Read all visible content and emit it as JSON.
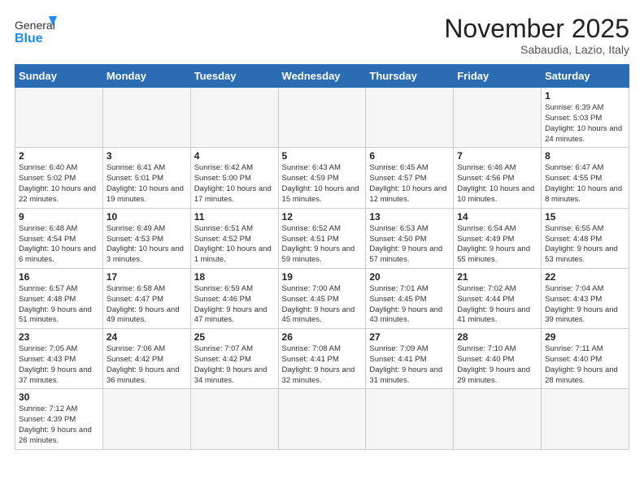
{
  "header": {
    "logo_general": "General",
    "logo_blue": "Blue",
    "month_title": "November 2025",
    "location": "Sabaudia, Lazio, Italy"
  },
  "weekdays": [
    "Sunday",
    "Monday",
    "Tuesday",
    "Wednesday",
    "Thursday",
    "Friday",
    "Saturday"
  ],
  "weeks": [
    [
      {
        "day": "",
        "info": ""
      },
      {
        "day": "",
        "info": ""
      },
      {
        "day": "",
        "info": ""
      },
      {
        "day": "",
        "info": ""
      },
      {
        "day": "",
        "info": ""
      },
      {
        "day": "",
        "info": ""
      },
      {
        "day": "1",
        "info": "Sunrise: 6:39 AM\nSunset: 5:03 PM\nDaylight: 10 hours\nand 24 minutes."
      }
    ],
    [
      {
        "day": "2",
        "info": "Sunrise: 6:40 AM\nSunset: 5:02 PM\nDaylight: 10 hours\nand 22 minutes."
      },
      {
        "day": "3",
        "info": "Sunrise: 6:41 AM\nSunset: 5:01 PM\nDaylight: 10 hours\nand 19 minutes."
      },
      {
        "day": "4",
        "info": "Sunrise: 6:42 AM\nSunset: 5:00 PM\nDaylight: 10 hours\nand 17 minutes."
      },
      {
        "day": "5",
        "info": "Sunrise: 6:43 AM\nSunset: 4:59 PM\nDaylight: 10 hours\nand 15 minutes."
      },
      {
        "day": "6",
        "info": "Sunrise: 6:45 AM\nSunset: 4:57 PM\nDaylight: 10 hours\nand 12 minutes."
      },
      {
        "day": "7",
        "info": "Sunrise: 6:46 AM\nSunset: 4:56 PM\nDaylight: 10 hours\nand 10 minutes."
      },
      {
        "day": "8",
        "info": "Sunrise: 6:47 AM\nSunset: 4:55 PM\nDaylight: 10 hours\nand 8 minutes."
      }
    ],
    [
      {
        "day": "9",
        "info": "Sunrise: 6:48 AM\nSunset: 4:54 PM\nDaylight: 10 hours\nand 6 minutes."
      },
      {
        "day": "10",
        "info": "Sunrise: 6:49 AM\nSunset: 4:53 PM\nDaylight: 10 hours\nand 3 minutes."
      },
      {
        "day": "11",
        "info": "Sunrise: 6:51 AM\nSunset: 4:52 PM\nDaylight: 10 hours\nand 1 minute."
      },
      {
        "day": "12",
        "info": "Sunrise: 6:52 AM\nSunset: 4:51 PM\nDaylight: 9 hours\nand 59 minutes."
      },
      {
        "day": "13",
        "info": "Sunrise: 6:53 AM\nSunset: 4:50 PM\nDaylight: 9 hours\nand 57 minutes."
      },
      {
        "day": "14",
        "info": "Sunrise: 6:54 AM\nSunset: 4:49 PM\nDaylight: 9 hours\nand 55 minutes."
      },
      {
        "day": "15",
        "info": "Sunrise: 6:55 AM\nSunset: 4:48 PM\nDaylight: 9 hours\nand 53 minutes."
      }
    ],
    [
      {
        "day": "16",
        "info": "Sunrise: 6:57 AM\nSunset: 4:48 PM\nDaylight: 9 hours\nand 51 minutes."
      },
      {
        "day": "17",
        "info": "Sunrise: 6:58 AM\nSunset: 4:47 PM\nDaylight: 9 hours\nand 49 minutes."
      },
      {
        "day": "18",
        "info": "Sunrise: 6:59 AM\nSunset: 4:46 PM\nDaylight: 9 hours\nand 47 minutes."
      },
      {
        "day": "19",
        "info": "Sunrise: 7:00 AM\nSunset: 4:45 PM\nDaylight: 9 hours\nand 45 minutes."
      },
      {
        "day": "20",
        "info": "Sunrise: 7:01 AM\nSunset: 4:45 PM\nDaylight: 9 hours\nand 43 minutes."
      },
      {
        "day": "21",
        "info": "Sunrise: 7:02 AM\nSunset: 4:44 PM\nDaylight: 9 hours\nand 41 minutes."
      },
      {
        "day": "22",
        "info": "Sunrise: 7:04 AM\nSunset: 4:43 PM\nDaylight: 9 hours\nand 39 minutes."
      }
    ],
    [
      {
        "day": "23",
        "info": "Sunrise: 7:05 AM\nSunset: 4:43 PM\nDaylight: 9 hours\nand 37 minutes."
      },
      {
        "day": "24",
        "info": "Sunrise: 7:06 AM\nSunset: 4:42 PM\nDaylight: 9 hours\nand 36 minutes."
      },
      {
        "day": "25",
        "info": "Sunrise: 7:07 AM\nSunset: 4:42 PM\nDaylight: 9 hours\nand 34 minutes."
      },
      {
        "day": "26",
        "info": "Sunrise: 7:08 AM\nSunset: 4:41 PM\nDaylight: 9 hours\nand 32 minutes."
      },
      {
        "day": "27",
        "info": "Sunrise: 7:09 AM\nSunset: 4:41 PM\nDaylight: 9 hours\nand 31 minutes."
      },
      {
        "day": "28",
        "info": "Sunrise: 7:10 AM\nSunset: 4:40 PM\nDaylight: 9 hours\nand 29 minutes."
      },
      {
        "day": "29",
        "info": "Sunrise: 7:11 AM\nSunset: 4:40 PM\nDaylight: 9 hours\nand 28 minutes."
      }
    ],
    [
      {
        "day": "30",
        "info": "Sunrise: 7:12 AM\nSunset: 4:39 PM\nDaylight: 9 hours\nand 26 minutes."
      },
      {
        "day": "",
        "info": ""
      },
      {
        "day": "",
        "info": ""
      },
      {
        "day": "",
        "info": ""
      },
      {
        "day": "",
        "info": ""
      },
      {
        "day": "",
        "info": ""
      },
      {
        "day": "",
        "info": ""
      }
    ]
  ]
}
